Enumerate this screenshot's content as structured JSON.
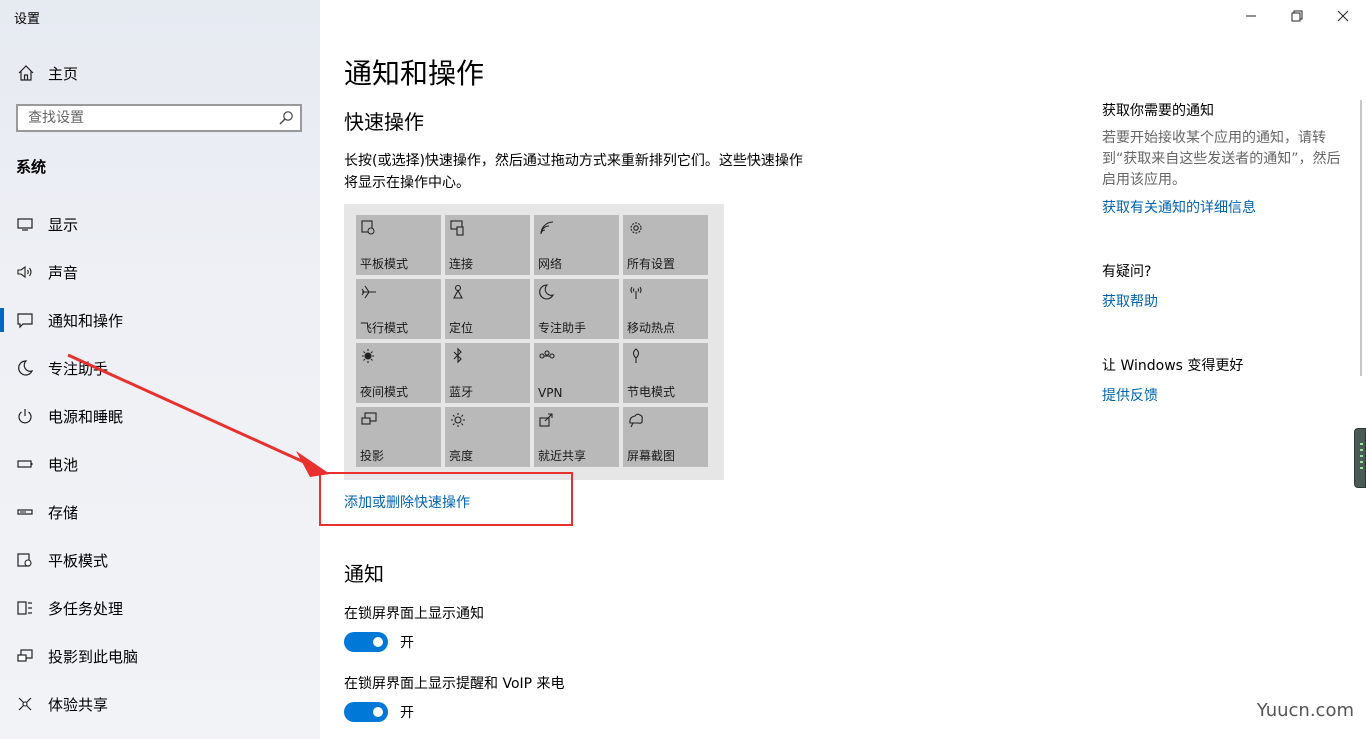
{
  "window": {
    "title": "设置"
  },
  "sidebar": {
    "home_label": "主页",
    "search_placeholder": "查找设置",
    "section_label": "系统",
    "items": [
      {
        "label": "显示",
        "icon": "monitor-icon"
      },
      {
        "label": "声音",
        "icon": "speaker-icon"
      },
      {
        "label": "通知和操作",
        "icon": "message-icon",
        "active": true
      },
      {
        "label": "专注助手",
        "icon": "moon-icon"
      },
      {
        "label": "电源和睡眠",
        "icon": "power-icon"
      },
      {
        "label": "电池",
        "icon": "battery-icon"
      },
      {
        "label": "存储",
        "icon": "storage-icon"
      },
      {
        "label": "平板模式",
        "icon": "tablet-icon"
      },
      {
        "label": "多任务处理",
        "icon": "multitask-icon"
      },
      {
        "label": "投影到此电脑",
        "icon": "project-icon"
      },
      {
        "label": "体验共享",
        "icon": "share-icon"
      }
    ]
  },
  "main": {
    "title": "通知和操作",
    "quick_actions": {
      "title": "快速操作",
      "description": "长按(或选择)快速操作，然后通过拖动方式来重新排列它们。这些快速操作将显示在操作中心。",
      "tiles": [
        {
          "label": "平板模式",
          "icon": "tablet-mode-icon"
        },
        {
          "label": "连接",
          "icon": "connect-icon"
        },
        {
          "label": "网络",
          "icon": "network-icon"
        },
        {
          "label": "所有设置",
          "icon": "gear-icon"
        },
        {
          "label": "飞行模式",
          "icon": "airplane-icon"
        },
        {
          "label": "定位",
          "icon": "location-icon"
        },
        {
          "label": "专注助手",
          "icon": "moon-icon"
        },
        {
          "label": "移动热点",
          "icon": "hotspot-icon"
        },
        {
          "label": "夜间模式",
          "icon": "night-light-icon"
        },
        {
          "label": "蓝牙",
          "icon": "bluetooth-icon"
        },
        {
          "label": "VPN",
          "icon": "vpn-icon"
        },
        {
          "label": "节电模式",
          "icon": "battery-saver-icon"
        },
        {
          "label": "投影",
          "icon": "project-icon"
        },
        {
          "label": "亮度",
          "icon": "brightness-icon"
        },
        {
          "label": "就近共享",
          "icon": "nearby-share-icon"
        },
        {
          "label": "屏幕截图",
          "icon": "screenshot-icon"
        }
      ],
      "link": "添加或删除快速操作"
    },
    "notifications": {
      "title": "通知",
      "settings": [
        {
          "label": "在锁屏界面上显示通知",
          "state": "开",
          "on": true
        },
        {
          "label": "在锁屏界面上显示提醒和 VoIP 来电",
          "state": "开",
          "on": true
        }
      ]
    }
  },
  "right": {
    "get_notifications": {
      "title": "获取你需要的通知",
      "text": "若要开始接收某个应用的通知，请转到“获取来自这些发送者的通知”，然后启用该应用。",
      "link": "获取有关通知的详细信息"
    },
    "questions": {
      "title": "有疑问?",
      "link": "获取帮助"
    },
    "feedback": {
      "title": "让 Windows 变得更好",
      "link": "提供反馈"
    }
  },
  "watermark": "Yuucn.com",
  "colors": {
    "accent": "#0078d7",
    "link": "#0063b1",
    "annotation": "#e8302f"
  }
}
